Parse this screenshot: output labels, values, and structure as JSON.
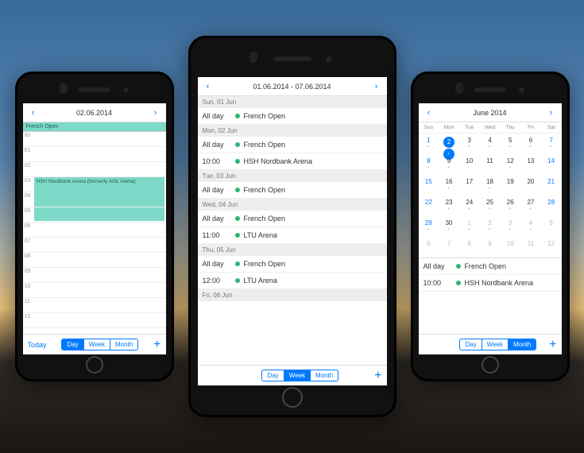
{
  "phones": {
    "day": {
      "title": "02.06.2014",
      "allday": "French Open",
      "hours": [
        "00",
        "01",
        "02",
        "03",
        "04",
        "05",
        "06",
        "07",
        "08",
        "09",
        "10",
        "11",
        "12"
      ],
      "event": {
        "label": "HSH Nordbank Arena (formerly AOL Arena)",
        "start": 3,
        "span": 3
      },
      "today": "Today",
      "tabs": [
        "Day",
        "Week",
        "Month"
      ],
      "active": 0
    },
    "week": {
      "title": "01.06.2014 - 07.06.2014",
      "sections": [
        {
          "h": "Sun, 01 Jun",
          "rows": [
            {
              "t": "All day",
              "e": "French Open"
            }
          ]
        },
        {
          "h": "Mon, 02 Jun",
          "rows": [
            {
              "t": "All day",
              "e": "French Open"
            },
            {
              "t": "10:00",
              "e": "HSH Nordbank Arena"
            }
          ]
        },
        {
          "h": "Tue, 03 Jun",
          "rows": [
            {
              "t": "All day",
              "e": "French Open"
            }
          ]
        },
        {
          "h": "Wed, 04 Jun",
          "rows": [
            {
              "t": "All day",
              "e": "French Open"
            },
            {
              "t": "11:00",
              "e": "LTU Arena"
            }
          ]
        },
        {
          "h": "Thu, 05 Jun",
          "rows": [
            {
              "t": "All day",
              "e": "French Open"
            },
            {
              "t": "12:00",
              "e": "LTU Arena"
            }
          ]
        },
        {
          "h": "Fri, 06 Jun",
          "rows": []
        }
      ],
      "tabs": [
        "Day",
        "Week",
        "Month"
      ],
      "active": 1
    },
    "month": {
      "title": "June 2014",
      "dow": [
        "Sun",
        "Mon",
        "Tue",
        "Wed",
        "Thu",
        "Fri",
        "Sat"
      ],
      "grid": [
        [
          {
            "n": 1,
            "b": 1,
            "m": 1
          },
          {
            "n": 2,
            "b": 1,
            "s": 1,
            "m": 1
          },
          {
            "n": 3,
            "m": 1
          },
          {
            "n": 4,
            "m": 1
          },
          {
            "n": 5,
            "m": 1
          },
          {
            "n": 6,
            "m": 1
          },
          {
            "n": 7,
            "b": 1,
            "m": 1
          }
        ],
        [
          {
            "n": 8,
            "b": 1,
            "m": 1
          },
          {
            "n": 9,
            "m": 1
          },
          {
            "n": 10
          },
          {
            "n": 11
          },
          {
            "n": 12,
            "m": 1
          },
          {
            "n": 13
          },
          {
            "n": 14,
            "b": 1
          }
        ],
        [
          {
            "n": 15,
            "b": 1
          },
          {
            "n": 16,
            "m": 1
          },
          {
            "n": 17
          },
          {
            "n": 18,
            "m": 1
          },
          {
            "n": 19
          },
          {
            "n": 20
          },
          {
            "n": 21,
            "b": 1
          }
        ],
        [
          {
            "n": 22,
            "b": 1
          },
          {
            "n": 23,
            "m": 1
          },
          {
            "n": 24,
            "m": 1
          },
          {
            "n": 25,
            "m": 1
          },
          {
            "n": 26,
            "m": 1
          },
          {
            "n": 27,
            "m": 1
          },
          {
            "n": 28,
            "b": 1
          }
        ],
        [
          {
            "n": 29,
            "b": 1,
            "m": 1
          },
          {
            "n": 30,
            "m": 1
          },
          {
            "n": 1,
            "o": 1,
            "m": 1
          },
          {
            "n": 2,
            "o": 1,
            "m": 1
          },
          {
            "n": 3,
            "o": 1,
            "m": 1
          },
          {
            "n": 4,
            "o": 1,
            "m": 1
          },
          {
            "n": 5,
            "o": 1
          }
        ],
        [
          {
            "n": 6,
            "o": 1
          },
          {
            "n": 7,
            "o": 1
          },
          {
            "n": 8,
            "o": 1
          },
          {
            "n": 9,
            "o": 1
          },
          {
            "n": 10,
            "o": 1
          },
          {
            "n": 11,
            "o": 1
          },
          {
            "n": 12,
            "o": 1
          }
        ]
      ],
      "events": [
        {
          "t": "All day",
          "e": "French Open"
        },
        {
          "t": "10:00",
          "e": "HSH Nordbank Arena"
        }
      ],
      "tabs": [
        "Day",
        "Week",
        "Month"
      ],
      "active": 2
    }
  }
}
